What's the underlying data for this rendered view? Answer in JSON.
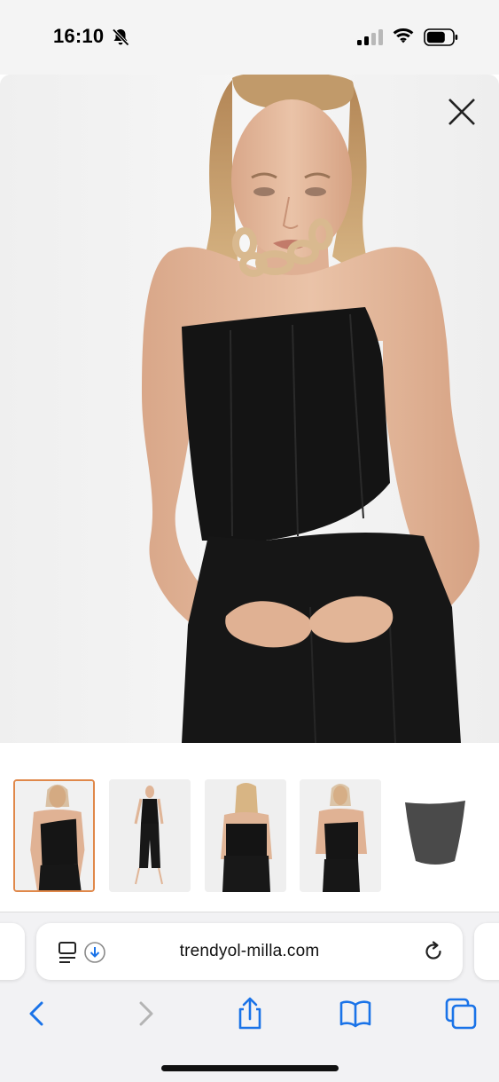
{
  "status_bar": {
    "time": "16:10",
    "icons": [
      "bell-slash-icon",
      "cellular-signal-icon",
      "wifi-icon",
      "battery-icon"
    ]
  },
  "viewer": {
    "image": "model-black-strapless-corset-top-photo",
    "close_icon": "close-icon",
    "background": "#f3f3f3"
  },
  "thumbnails": [
    {
      "name": "front-closeup",
      "selected": true
    },
    {
      "name": "full-body-front",
      "selected": false
    },
    {
      "name": "back-view",
      "selected": false
    },
    {
      "name": "side-front",
      "selected": false
    },
    {
      "name": "product-flat",
      "selected": false
    }
  ],
  "browser": {
    "url": "trendyol-milla.com",
    "icons": {
      "reader": "reader-icon",
      "download": "download-icon",
      "reload": "reload-icon",
      "back": "back-chevron-icon",
      "forward": "forward-chevron-icon",
      "share": "share-icon",
      "bookmarks": "bookmarks-icon",
      "tabs": "tabs-icon"
    },
    "accent": "#1a73e8"
  },
  "colors": {
    "selected_thumb_border": "#e0884a",
    "garment": "#141414",
    "skin": "#e2b69a"
  }
}
